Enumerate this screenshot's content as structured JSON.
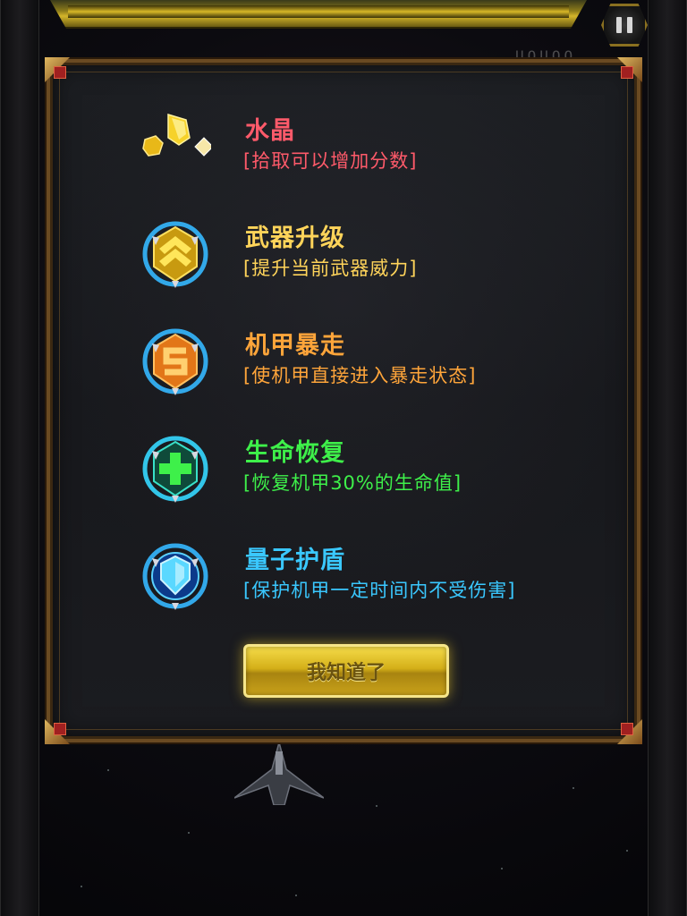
{
  "hud": {
    "score_ghost": "UOUOO",
    "pause_icon": "pause-icon"
  },
  "dialog": {
    "items": [
      {
        "icon": "crystal-icon",
        "title": "水晶",
        "desc": "[拾取可以增加分数]",
        "color": "#ff5a6a"
      },
      {
        "icon": "weapon-upgrade-icon",
        "title": "武器升级",
        "desc": "[提升当前武器威力]",
        "color": "#ffd45a"
      },
      {
        "icon": "mech-rampage-icon",
        "title": "机甲暴走",
        "desc": "[使机甲直接进入暴走状态]",
        "color": "#ffa53a"
      },
      {
        "icon": "health-restore-icon",
        "title": "生命恢复",
        "desc": "[恢复机甲30%的生命值]",
        "color": "#3ef04a"
      },
      {
        "icon": "quantum-shield-icon",
        "title": "量子护盾",
        "desc": "[保护机甲一定时间内不受伤害]",
        "color": "#3ac8ff"
      }
    ],
    "confirm_label": "我知道了"
  },
  "colors": {
    "frame": "#6a4a22",
    "button_gold": "#d4af18",
    "panel": "#1b1c20"
  }
}
